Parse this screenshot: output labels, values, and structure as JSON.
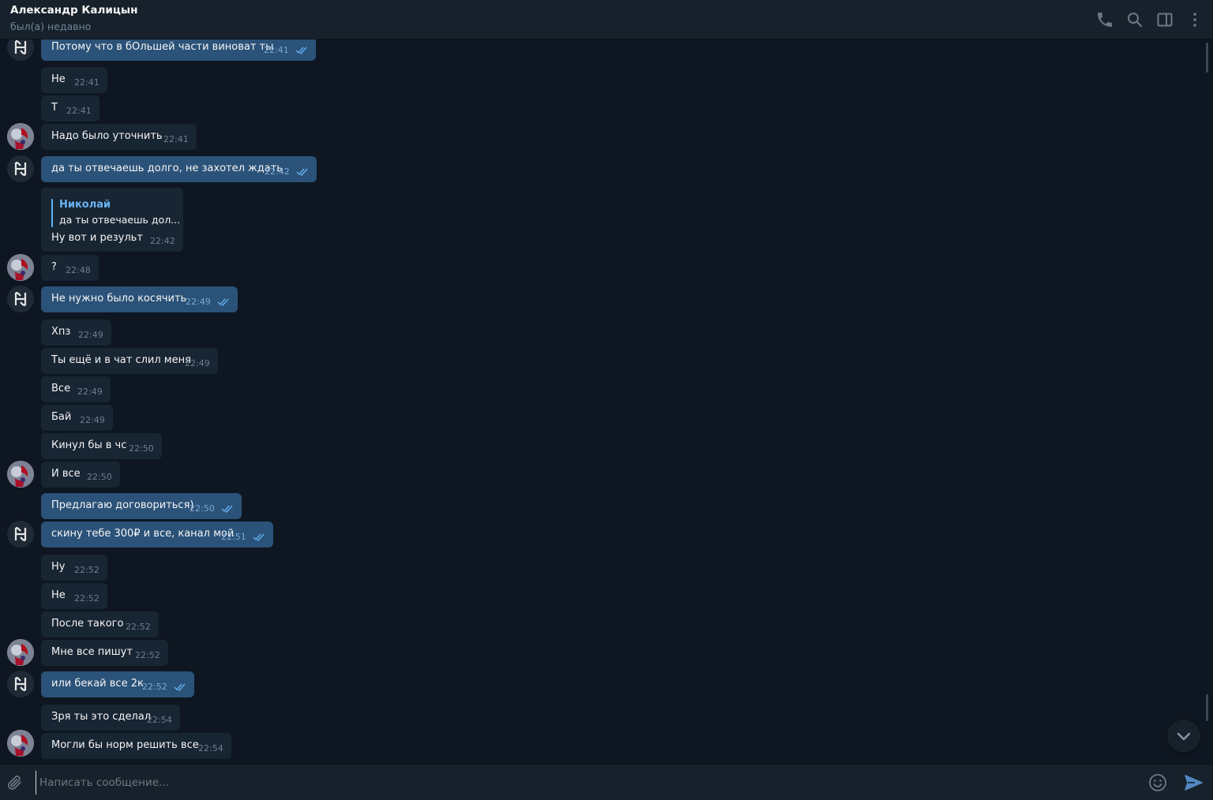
{
  "header": {
    "title": "Александр Калицын",
    "status": "был(а) недавно",
    "icons": [
      "phone-icon",
      "search-icon",
      "sidebar-toggle-icon",
      "more-vertical-icon"
    ]
  },
  "messages": [
    {
      "text": "Потому что в бОльшей части виноват ты",
      "time": "22:41",
      "outgoing": true,
      "read": true
    },
    {
      "text": "Не",
      "time": "22:41",
      "outgoing": false
    },
    {
      "text": "Т",
      "time": "22:41",
      "outgoing": false
    },
    {
      "text": "Надо было уточнить",
      "time": "22:41",
      "outgoing": false
    },
    {
      "text": "да ты отвечаешь долго, не захотел ждать",
      "time": "22:42",
      "outgoing": true,
      "read": true
    },
    {
      "text": "Ну вот и результ",
      "time": "22:42",
      "outgoing": false,
      "reply_to": {
        "name": "Николай",
        "text": "да ты отвечаешь дол..."
      }
    },
    {
      "text": "?",
      "time": "22:48",
      "outgoing": false
    },
    {
      "text": "Не нужно было косячить",
      "time": "22:49",
      "outgoing": true,
      "read": true
    },
    {
      "text": "Хпз",
      "time": "22:49",
      "outgoing": false
    },
    {
      "text": "Ты ещё и в чат слил меня",
      "time": "22:49",
      "outgoing": false
    },
    {
      "text": "Все",
      "time": "22:49",
      "outgoing": false
    },
    {
      "text": "Бай",
      "time": "22:49",
      "outgoing": false
    },
    {
      "text": "Кинул бы в чс",
      "time": "22:50",
      "outgoing": false
    },
    {
      "text": "И все",
      "time": "22:50",
      "outgoing": false
    },
    {
      "text": "Предлагаю договориться)",
      "time": "22:50",
      "outgoing": true,
      "read": true
    },
    {
      "text": "скину тебе 300₽ и все, канал мой",
      "time": "22:51",
      "outgoing": true,
      "read": true
    },
    {
      "text": "Ну",
      "time": "22:52",
      "outgoing": false
    },
    {
      "text": "Не",
      "time": "22:52",
      "outgoing": false
    },
    {
      "text": "После такого",
      "time": "22:52",
      "outgoing": false
    },
    {
      "text": "Мне все пишут",
      "time": "22:52",
      "outgoing": false
    },
    {
      "text": "или бекай все 2к",
      "time": "22:52",
      "outgoing": true,
      "read": true
    },
    {
      "text": "Зря ты это сделал",
      "time": "22:54",
      "outgoing": false
    },
    {
      "text": "Могли бы норм решить все",
      "time": "22:54",
      "outgoing": false
    }
  ],
  "composer": {
    "placeholder": "Написать сообщение..."
  },
  "colors": {
    "background": "#0e1621",
    "header": "#17212b",
    "incoming_bubble": "#182533",
    "outgoing_bubble": "#2b5278",
    "accent": "#5eb5f7"
  }
}
